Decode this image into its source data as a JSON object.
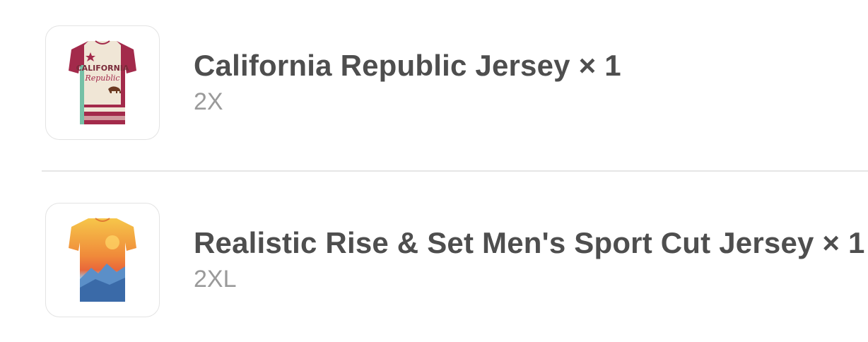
{
  "items": [
    {
      "title": "California Republic Jersey × 1",
      "variant": "2X",
      "thumbnail_icon": "california-republic-jersey-image",
      "colors": {
        "primary": "#a32a4b",
        "secondary": "#f0e6d6",
        "accent": "#76c0a6"
      }
    },
    {
      "title": "Realistic Rise & Set Men's Sport Cut Jersey × 1",
      "variant": "2XL",
      "thumbnail_icon": "rise-and-set-jersey-image",
      "colors": {
        "primary": "#f2a23a",
        "secondary": "#e9673a",
        "accent": "#4a86c5"
      }
    }
  ],
  "colors": {
    "title_text": "#4e4e4e",
    "variant_text": "#9a9a9a",
    "divider": "#e6e6e6",
    "thumb_border": "#e3e3e3"
  }
}
